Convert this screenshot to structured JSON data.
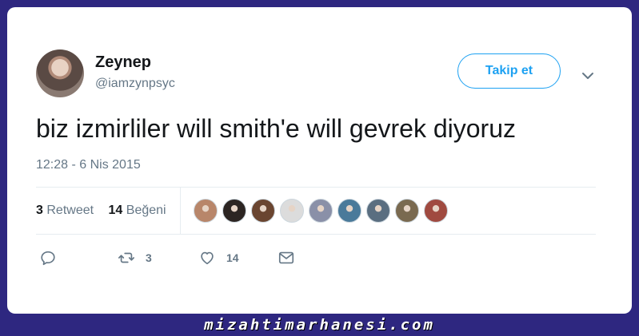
{
  "tweet": {
    "name": "Zeynep",
    "handle": "@iamzynpsyc",
    "follow_label": "Takip et",
    "text": "biz izmirliler will smith'e will gevrek diyoruz",
    "timestamp": "12:28 - 6 Nis 2015"
  },
  "stats": {
    "retweet_count": "3",
    "retweet_label": "Retweet",
    "like_count": "14",
    "like_label": "Beğeni",
    "liker_colors": [
      "#b8866a",
      "#2c2522",
      "#6a4530",
      "#dcdcdc",
      "#8a90a8",
      "#4a7a9a",
      "#5a6e80",
      "#7a6a50",
      "#a04a40"
    ]
  },
  "actions": {
    "reply_icon": "reply-icon",
    "retweet_icon": "retweet-icon",
    "retweet_count": "3",
    "like_icon": "heart-icon",
    "like_count": "14",
    "dm_icon": "envelope-icon"
  },
  "footer": {
    "watermark": "mizahtimarhanesi.com"
  },
  "colors": {
    "background": "#2e2780",
    "accent": "#1da1f2",
    "secondary_text": "#657786"
  }
}
